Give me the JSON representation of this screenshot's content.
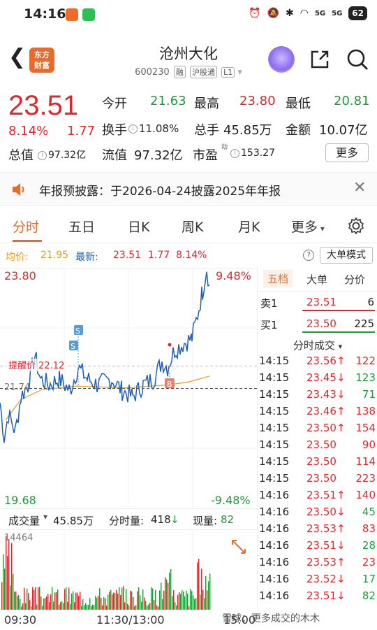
{
  "status": {
    "time": "14:16",
    "signal_4g": "5G",
    "signal_5g": "5G",
    "battery": "62"
  },
  "header": {
    "logo_line1": "东方",
    "logo_line2": "财富",
    "name": "沧州大化",
    "code": "600230",
    "tag1": "融",
    "tag2": "沪股通",
    "tag3": "L1"
  },
  "quote": {
    "price": "23.51",
    "pct": "8.14%",
    "change": "1.77",
    "open_label": "今开",
    "open": "21.63",
    "high_label": "最高",
    "high": "23.80",
    "low_label": "最低",
    "low": "20.81",
    "turnover_label": "换手",
    "turnover": "11.08%",
    "volume_label": "总手",
    "volume": "45.85万",
    "amount_label": "金额",
    "amount": "10.07亿",
    "mcap_label": "总值",
    "mcap": "97.32亿",
    "float_label": "流值",
    "float": "97.32亿",
    "pe_label": "市盈",
    "pe_sup": "动",
    "pe": "153.27",
    "more": "更多"
  },
  "notice": {
    "text": "年报预披露：于2026-04-24披露2025年年报"
  },
  "tabs": [
    "分时",
    "五日",
    "日K",
    "周K",
    "月K",
    "更多"
  ],
  "avgbar": {
    "avg_label": "均价:",
    "avg": "21.95",
    "last_label": "最新:",
    "last": "23.51",
    "last_chg": "1.77",
    "last_pct": "8.14%",
    "big_order": "大单模式"
  },
  "chart_labels": {
    "y_top": "23.80",
    "y_top_pct": "9.48%",
    "y_bottom": "19.68",
    "y_bottom_pct": "-9.48%",
    "y_prev": "21.74",
    "alert": "提醒价 22.12",
    "marker_s": "S",
    "marker_b": "B"
  },
  "side": {
    "tabs": [
      "五档",
      "大单",
      "分价"
    ],
    "sell1_label": "卖1",
    "sell1_price": "23.51",
    "sell1_vol": "6",
    "buy1_label": "买1",
    "buy1_price": "23.50",
    "buy1_vol": "225",
    "ticks_title": "分时成交",
    "ticks": [
      {
        "t": "14:15",
        "p": "23.56",
        "v": "122",
        "d": "up"
      },
      {
        "t": "14:15",
        "p": "23.45",
        "v": "123",
        "d": "down"
      },
      {
        "t": "14:15",
        "p": "23.43",
        "v": "71",
        "d": "down"
      },
      {
        "t": "14:15",
        "p": "23.46",
        "v": "138",
        "d": "up"
      },
      {
        "t": "14:15",
        "p": "23.50",
        "v": "154",
        "d": "up"
      },
      {
        "t": "14:15",
        "p": "23.50",
        "v": "90",
        "d": "none"
      },
      {
        "t": "14:15",
        "p": "23.50",
        "v": "114",
        "d": "none"
      },
      {
        "t": "14:15",
        "p": "23.50",
        "v": "223",
        "d": "none"
      },
      {
        "t": "14:16",
        "p": "23.51",
        "v": "140",
        "d": "up"
      },
      {
        "t": "14:16",
        "p": "23.50",
        "v": "45",
        "d": "down"
      },
      {
        "t": "14:16",
        "p": "23.53",
        "v": "83",
        "d": "up"
      },
      {
        "t": "14:16",
        "p": "23.51",
        "v": "28",
        "d": "down"
      },
      {
        "t": "14:16",
        "p": "23.53",
        "v": "23",
        "d": "up"
      },
      {
        "t": "14:16",
        "p": "23.52",
        "v": "17",
        "d": "down"
      },
      {
        "t": "14:16",
        "p": "23.51",
        "v": "82",
        "d": "down"
      }
    ]
  },
  "volume": {
    "label": "成交量",
    "total": "45.85万",
    "minute_label": "分时量:",
    "minute": "418",
    "current_label": "现量:",
    "current": "82",
    "max": "14464"
  },
  "time_axis": [
    "09:30",
    "11:30/13:00",
    "15:00"
  ],
  "watermark": "雪球：更多成交的木木",
  "colors": {
    "up": "#e0272d",
    "down": "#1f9a3a",
    "accent": "#e86b2a",
    "price_line": "#1f5fb5",
    "avg_line": "#f0a030"
  }
}
